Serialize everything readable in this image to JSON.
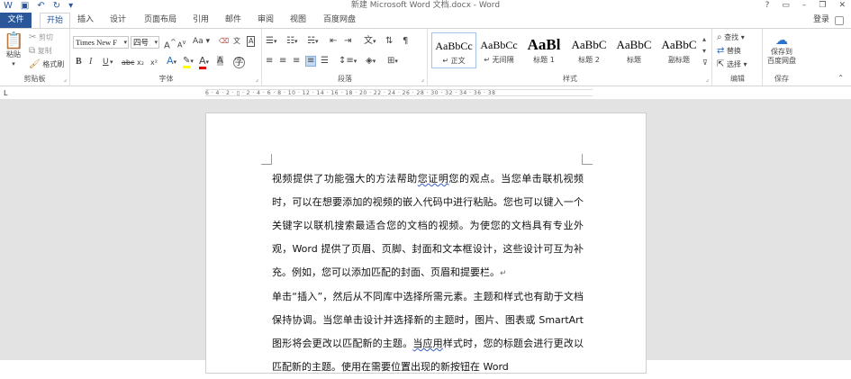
{
  "window": {
    "title": "新建 Microsoft Word 文档.docx - Word",
    "controls": [
      "?",
      "▭",
      "–",
      "❐",
      "✕"
    ]
  },
  "qat": {
    "icons": [
      "word-icon",
      "save-icon",
      "undo-icon",
      "redo-icon",
      "customize-icon"
    ]
  },
  "tabs": [
    {
      "label": "文件"
    },
    {
      "label": "开始"
    },
    {
      "label": "插入"
    },
    {
      "label": "设计"
    },
    {
      "label": "页面布局"
    },
    {
      "label": "引用"
    },
    {
      "label": "邮件"
    },
    {
      "label": "审阅"
    },
    {
      "label": "视图"
    },
    {
      "label": "百度网盘"
    }
  ],
  "login_label": "登录",
  "ribbon": {
    "clipboard": {
      "label": "剪贴板",
      "paste": "粘贴",
      "cut": "剪切",
      "copy": "复制",
      "format_painter": "格式刷"
    },
    "font": {
      "label": "字体",
      "font_name": "Times New F",
      "font_size": "四号",
      "grow": "A",
      "shrink": "A",
      "case": "Aa",
      "bold": "B",
      "italic": "I",
      "underline": "U",
      "strike": "abc",
      "sub": "x₂",
      "sup": "x²"
    },
    "paragraph": {
      "label": "段落"
    },
    "styles": {
      "label": "样式",
      "items": [
        {
          "preview": "AaBbCc",
          "name": "↵ 正文"
        },
        {
          "preview": "AaBbCc",
          "name": "↵ 无间隔"
        },
        {
          "preview": "AaBl",
          "name": "标题 1"
        },
        {
          "preview": "AaBbC",
          "name": "标题 2"
        },
        {
          "preview": "AaBbC",
          "name": "标题"
        },
        {
          "preview": "AaBbC",
          "name": "副标题"
        }
      ]
    },
    "editing": {
      "label": "编辑",
      "find": "查找",
      "replace": "替换",
      "select": "选择"
    },
    "save": {
      "label": "保存",
      "button_line1": "保存到",
      "button_line2": "百度网盘"
    }
  },
  "ruler": {
    "marks": "6 · 4 · 2 · ▯ · 2 · 4 · 6 · 8 · 10 · 12 · 14 · 16 · 18 · 20 · 22 · 24 · 26 · 28 · 30 · 32 · 34 · 36 · 38"
  },
  "document": {
    "p1": {
      "a": "视频提供了功能强大的方法帮助",
      "b": "您证明",
      "c": "您的观点。当您单击联机视频时，可以在想要添加的视频的嵌入代码中进行粘贴。您也可以键入一个关键字以联机搜索最适合您的文档的视频。为使您的文档具有专业外观，Word 提供了页眉、页脚、封面和文本框设计，这些设计可互为补充。例如，您可以添加匹配的封面、页眉和提要栏。",
      "mark": "↵"
    },
    "p2": {
      "a": "单击“插入”，然后从不同库中选择所需元素。主题和样式也有助于文档保持协调。当您单击设计并选择新的主题时，图片、图表或 SmartArt 图形将会更改以匹配新的主题。",
      "b": "当应用",
      "c": "样式时，您的标题会进行更改以匹配新的主题。使用在需要位置出现的新按钮在 Word"
    }
  }
}
